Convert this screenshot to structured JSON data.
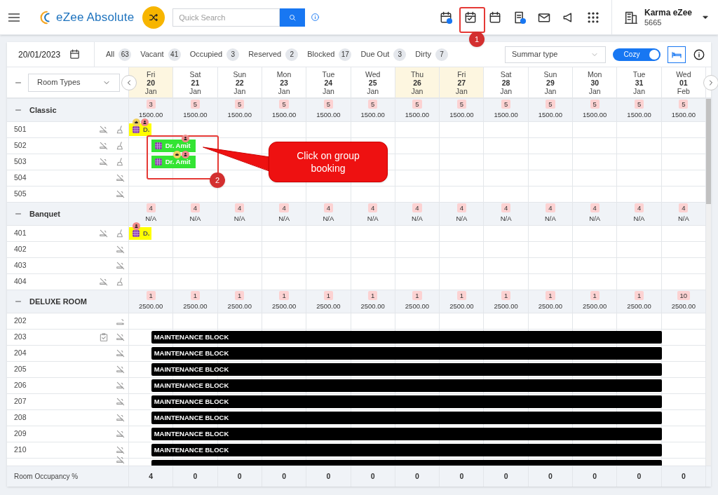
{
  "topbar": {
    "app_name": "eZee Absolute",
    "search": {
      "placeholder": "Quick Search"
    },
    "account": {
      "name": "Karma eZee",
      "code": "5665"
    }
  },
  "toolbar": {
    "date": "20/01/2023",
    "filters": [
      {
        "label": "All",
        "count": "63"
      },
      {
        "label": "Vacant",
        "count": "41"
      },
      {
        "label": "Occupied",
        "count": "3"
      },
      {
        "label": "Reserved",
        "count": "2"
      },
      {
        "label": "Blocked",
        "count": "17"
      },
      {
        "label": "Due Out",
        "count": "3"
      },
      {
        "label": "Dirty",
        "count": "7"
      }
    ],
    "summary_select": {
      "placeholder": "Summar type"
    },
    "view_toggle": {
      "label": "Cozy",
      "on": true
    }
  },
  "grid": {
    "room_type_select": "Room Types",
    "days": [
      {
        "weekday": "Fri",
        "day": "20",
        "month": "Jan",
        "highlighted": true
      },
      {
        "weekday": "Sat",
        "day": "21",
        "month": "Jan",
        "highlighted": false
      },
      {
        "weekday": "Sun",
        "day": "22",
        "month": "Jan",
        "highlighted": false
      },
      {
        "weekday": "Mon",
        "day": "23",
        "month": "Jan",
        "highlighted": false
      },
      {
        "weekday": "Tue",
        "day": "24",
        "month": "Jan",
        "highlighted": false
      },
      {
        "weekday": "Wed",
        "day": "25",
        "month": "Jan",
        "highlighted": false
      },
      {
        "weekday": "Thu",
        "day": "26",
        "month": "Jan",
        "highlighted": true
      },
      {
        "weekday": "Fri",
        "day": "27",
        "month": "Jan",
        "highlighted": true
      },
      {
        "weekday": "Sat",
        "day": "28",
        "month": "Jan",
        "highlighted": false
      },
      {
        "weekday": "Sun",
        "day": "29",
        "month": "Jan",
        "highlighted": false
      },
      {
        "weekday": "Mon",
        "day": "30",
        "month": "Jan",
        "highlighted": false
      },
      {
        "weekday": "Tue",
        "day": "31",
        "month": "Jan",
        "highlighted": false
      },
      {
        "weekday": "Wed",
        "day": "01",
        "month": "Feb",
        "highlighted": false
      }
    ],
    "groups": [
      {
        "name": "Classic",
        "availability": [
          "3",
          "5",
          "5",
          "5",
          "5",
          "5",
          "5",
          "5",
          "5",
          "5",
          "5",
          "5",
          "5"
        ],
        "rates": [
          "1500.00",
          "1500.00",
          "1500.00",
          "1500.00",
          "1500.00",
          "1500.00",
          "1500.00",
          "1500.00",
          "1500.00",
          "1500.00",
          "1500.00",
          "1500.00",
          "1500.00"
        ],
        "rooms": [
          {
            "number": "501",
            "smoking_allowed": false,
            "dirty": true,
            "bookings": [
              {
                "kind": "departing",
                "label": "D.",
                "vip": true,
                "group_booking": true
              }
            ]
          },
          {
            "number": "502",
            "smoking_allowed": false,
            "dirty": true,
            "bookings": [
              {
                "kind": "group",
                "label": "Dr. Amit",
                "vip": false,
                "group_booking": true
              }
            ]
          },
          {
            "number": "503",
            "smoking_allowed": false,
            "dirty": true,
            "bookings": [
              {
                "kind": "group",
                "label": "Dr. Amit",
                "vip": true,
                "group_booking": true
              }
            ]
          },
          {
            "number": "504",
            "smoking_allowed": false,
            "dirty": false
          },
          {
            "number": "505",
            "smoking_allowed": false,
            "dirty": false
          }
        ]
      },
      {
        "name": "Banquet",
        "availability": [
          "4",
          "4",
          "4",
          "4",
          "4",
          "4",
          "4",
          "4",
          "4",
          "4",
          "4",
          "4",
          "4"
        ],
        "rates": [
          "N/A",
          "N/A",
          "N/A",
          "N/A",
          "N/A",
          "N/A",
          "N/A",
          "N/A",
          "N/A",
          "N/A",
          "N/A",
          "N/A",
          "N/A"
        ],
        "rooms": [
          {
            "number": "401",
            "smoking_allowed": false,
            "dirty": true,
            "bookings": [
              {
                "kind": "departing",
                "label": "D.",
                "vip": false,
                "group_booking": true
              }
            ]
          },
          {
            "number": "402",
            "smoking_allowed": false,
            "dirty": false
          },
          {
            "number": "403",
            "smoking_allowed": false,
            "dirty": false
          },
          {
            "number": "404",
            "smoking_allowed": false,
            "dirty": true
          }
        ]
      },
      {
        "name": "DELUXE ROOM",
        "availability": [
          "1",
          "1",
          "1",
          "1",
          "1",
          "1",
          "1",
          "1",
          "1",
          "1",
          "1",
          "1",
          "10"
        ],
        "rates": [
          "2500.00",
          "2500.00",
          "2500.00",
          "2500.00",
          "2500.00",
          "2500.00",
          "2500.00",
          "2500.00",
          "2500.00",
          "2500.00",
          "2500.00",
          "2500.00",
          "2500.00"
        ],
        "rooms": [
          {
            "number": "202",
            "smoking_allowed": true,
            "dirty": false
          },
          {
            "number": "203",
            "smoking_allowed": false,
            "dirty": false,
            "inspected": true,
            "bookings": [
              {
                "kind": "block",
                "label": "MAINTENANCE BLOCK"
              }
            ]
          },
          {
            "number": "204",
            "smoking_allowed": false,
            "dirty": false,
            "bookings": [
              {
                "kind": "block",
                "label": "MAINTENANCE BLOCK"
              }
            ]
          },
          {
            "number": "205",
            "smoking_allowed": false,
            "dirty": false,
            "bookings": [
              {
                "kind": "block",
                "label": "MAINTENANCE BLOCK"
              }
            ]
          },
          {
            "number": "206",
            "smoking_allowed": false,
            "dirty": false,
            "bookings": [
              {
                "kind": "block",
                "label": "MAINTENANCE BLOCK"
              }
            ]
          },
          {
            "number": "207",
            "smoking_allowed": false,
            "dirty": false,
            "bookings": [
              {
                "kind": "block",
                "label": "MAINTENANCE BLOCK"
              }
            ]
          },
          {
            "number": "208",
            "smoking_allowed": false,
            "dirty": false,
            "bookings": [
              {
                "kind": "block",
                "label": "MAINTENANCE BLOCK"
              }
            ]
          },
          {
            "number": "209",
            "smoking_allowed": false,
            "dirty": false,
            "bookings": [
              {
                "kind": "block",
                "label": "MAINTENANCE BLOCK"
              }
            ]
          },
          {
            "number": "210",
            "smoking_allowed": false,
            "dirty": false,
            "bookings": [
              {
                "kind": "block",
                "label": "MAINTENANCE BLOCK"
              }
            ]
          },
          {
            "smoking_allowed": false,
            "dirty": false,
            "bookings": [
              {
                "kind": "block"
              }
            ]
          }
        ]
      }
    ],
    "footer": {
      "label": "Room Occupancy %",
      "values": [
        "4",
        "0",
        "0",
        "0",
        "0",
        "0",
        "0",
        "0",
        "0",
        "0",
        "0",
        "0",
        "0"
      ]
    }
  },
  "annotations": [
    {
      "number": "1"
    },
    {
      "number": "2"
    }
  ],
  "callout": {
    "text": "Click on group booking"
  }
}
